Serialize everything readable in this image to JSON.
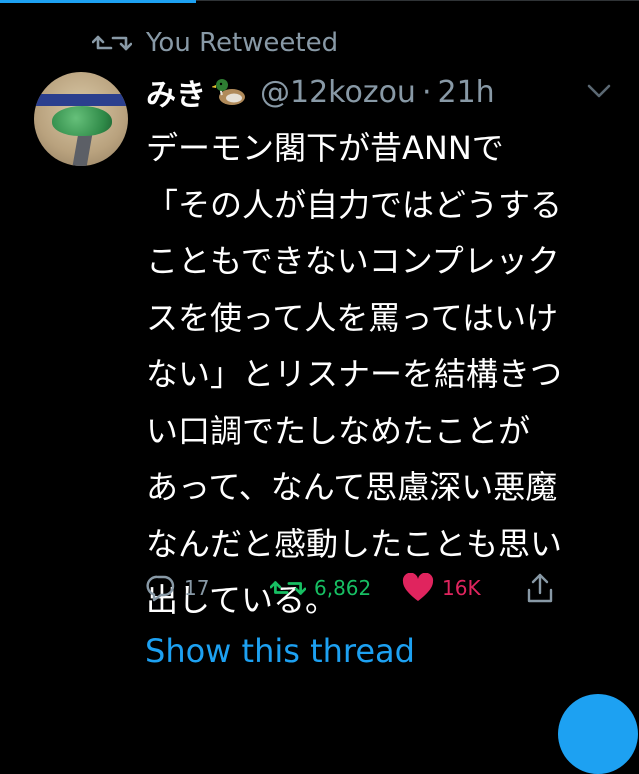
{
  "retweet_header": {
    "label": "You Retweeted",
    "icon": "retweet-icon"
  },
  "tweet": {
    "author": {
      "display_name": "みき",
      "emoji": "duck-emoji",
      "handle": "@12kozou",
      "separator": "·",
      "time": "21h"
    },
    "text_lines": [
      "デーモン閣下が昔ANNで",
      "「その人が自力ではどうする",
      "こともできないコンプレック",
      "スを使って人を罵ってはいけ",
      "ない」とリスナーを結構きつ",
      "い口調でたしなめたことが",
      "あって、なんて思慮深い悪魔",
      "なんだと感動したことも思い",
      "出している。"
    ],
    "actions": {
      "reply_count": "17",
      "retweet_count": "6,862",
      "like_count": "16K"
    },
    "show_thread": "Show this thread"
  },
  "colors": {
    "background": "#000000",
    "secondary_text": "#8899a6",
    "accent_blue": "#1da1f2",
    "retweet_green": "#17bf63",
    "like_pink": "#e0245e"
  }
}
